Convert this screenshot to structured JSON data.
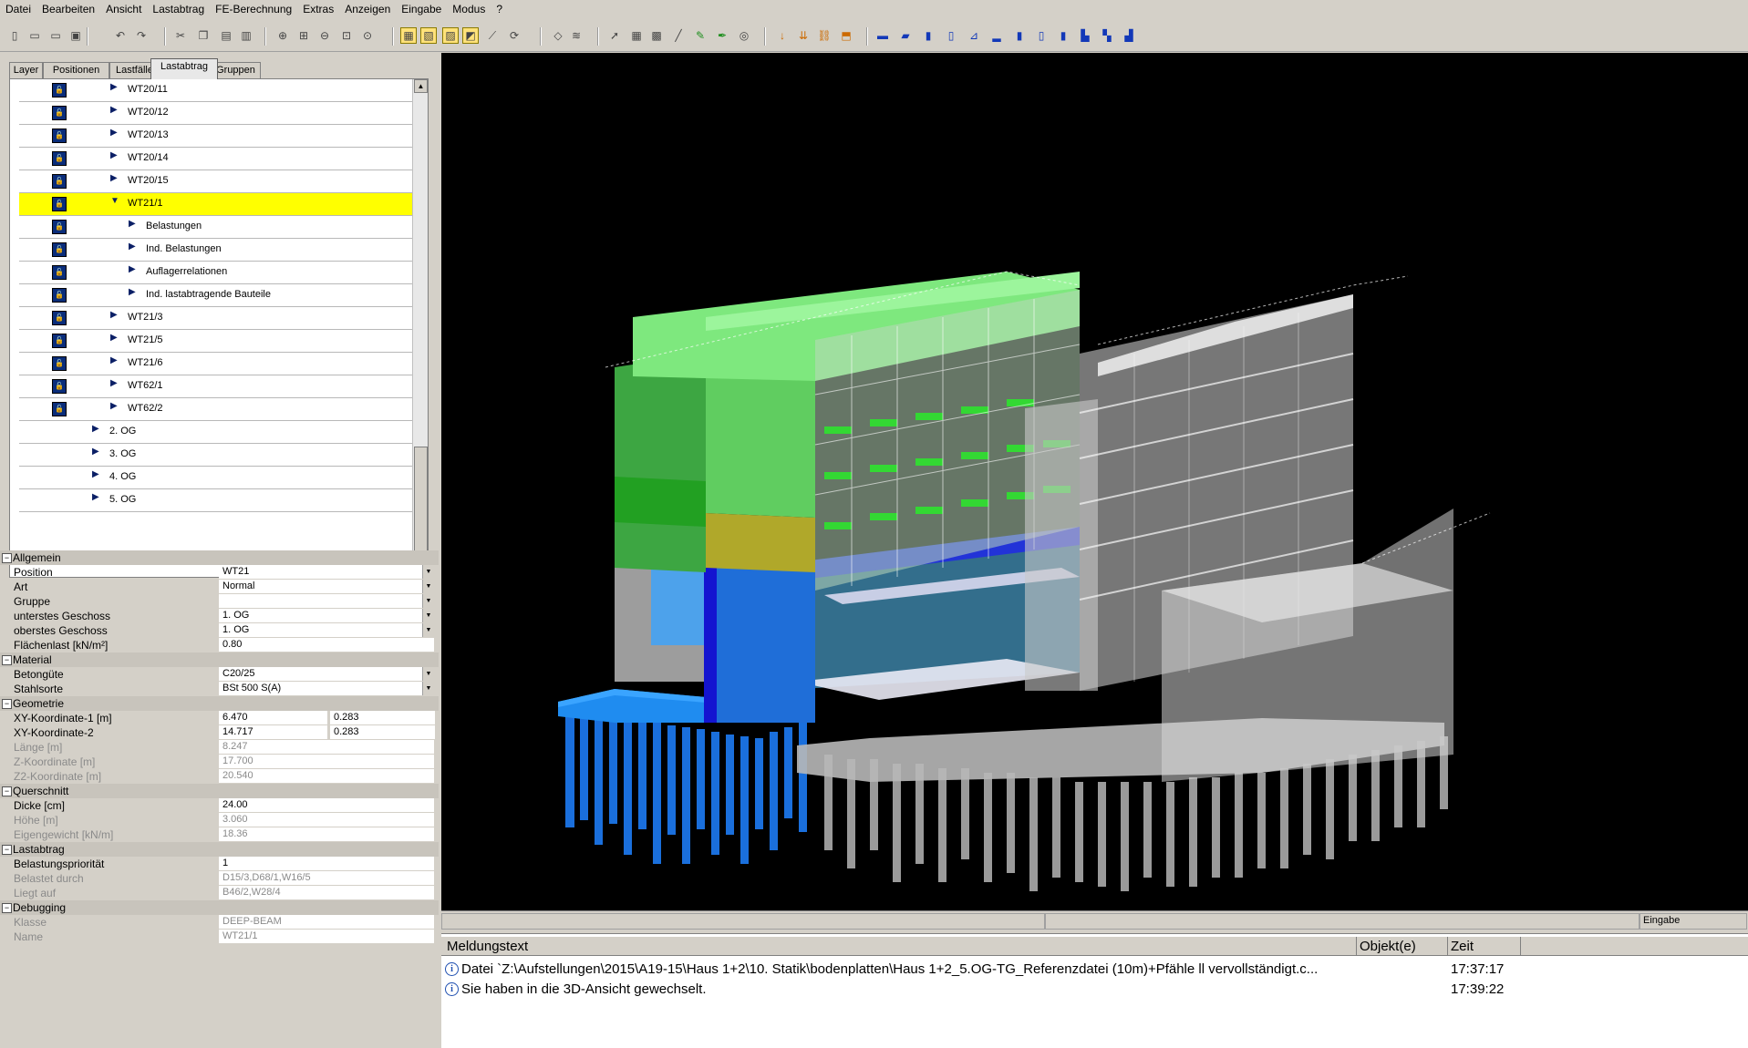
{
  "menu": [
    "Datei",
    "Bearbeiten",
    "Ansicht",
    "Lastabtrag",
    "FE-Berechnung",
    "Extras",
    "Anzeigen",
    "Eingabe",
    "Modus",
    "?"
  ],
  "toolbar_icons": [
    "new-file-icon",
    "open-file-icon",
    "open-file-icon",
    "save-icon",
    "undo-icon",
    "redo-icon",
    "cut-icon",
    "copy-icon",
    "paste-icon",
    "paste-special-icon",
    "zoom-in-icon",
    "zoom-window-icon",
    "zoom-out-icon",
    "zoom-all-icon",
    "zoom-previous-icon",
    "view-top-icon",
    "view-front-icon",
    "view-side-icon",
    "view-3d-icon",
    "measure-icon",
    "rotate-icon",
    "eraser-icon",
    "layers-icon",
    "select-arrow-icon",
    "grid-icon",
    "grid-fine-icon",
    "line-icon",
    "pencil-icon",
    "pen-icon",
    "snap-icon",
    "load-arrow-icon",
    "load-group-icon",
    "load-chain-icon",
    "load-area-icon",
    "beam-icon",
    "slab-icon",
    "wall-icon",
    "column-icon",
    "stair-icon",
    "foundation-icon"
  ],
  "tabs": [
    "Layer",
    "Positionen",
    "Lastfälle",
    "Lastabtrag",
    "Gruppen"
  ],
  "tree": [
    {
      "label": "WT20/11",
      "level": 2,
      "lock": true,
      "expanded": false,
      "selected": false
    },
    {
      "label": "WT20/12",
      "level": 2,
      "lock": true,
      "expanded": false,
      "selected": false
    },
    {
      "label": "WT20/13",
      "level": 2,
      "lock": true,
      "expanded": false,
      "selected": false
    },
    {
      "label": "WT20/14",
      "level": 2,
      "lock": true,
      "expanded": false,
      "selected": false
    },
    {
      "label": "WT20/15",
      "level": 2,
      "lock": true,
      "expanded": false,
      "selected": false
    },
    {
      "label": "WT21/1",
      "level": 2,
      "lock": true,
      "expanded": true,
      "selected": true
    },
    {
      "label": "Belastungen",
      "level": 3,
      "lock": true,
      "expanded": false,
      "selected": false
    },
    {
      "label": "Ind. Belastungen",
      "level": 3,
      "lock": true,
      "expanded": false,
      "selected": false
    },
    {
      "label": "Auflagerrelationen",
      "level": 3,
      "lock": true,
      "expanded": false,
      "selected": false
    },
    {
      "label": "Ind. lastabtragende Bauteile",
      "level": 3,
      "lock": true,
      "expanded": false,
      "selected": false
    },
    {
      "label": "WT21/3",
      "level": 2,
      "lock": true,
      "expanded": false,
      "selected": false
    },
    {
      "label": "WT21/5",
      "level": 2,
      "lock": true,
      "expanded": false,
      "selected": false
    },
    {
      "label": "WT21/6",
      "level": 2,
      "lock": true,
      "expanded": false,
      "selected": false
    },
    {
      "label": "WT62/1",
      "level": 2,
      "lock": true,
      "expanded": false,
      "selected": false
    },
    {
      "label": "WT62/2",
      "level": 2,
      "lock": true,
      "expanded": false,
      "selected": false
    },
    {
      "label": "2. OG",
      "level": 1,
      "lock": false,
      "expanded": false,
      "selected": false
    },
    {
      "label": "3. OG",
      "level": 1,
      "lock": false,
      "expanded": false,
      "selected": false
    },
    {
      "label": "4. OG",
      "level": 1,
      "lock": false,
      "expanded": false,
      "selected": false
    },
    {
      "label": "5. OG",
      "level": 1,
      "lock": false,
      "expanded": false,
      "selected": false
    }
  ],
  "properties": [
    {
      "type": "head",
      "label": "Allgemein"
    },
    {
      "type": "row",
      "label": "Position",
      "value": "WT21",
      "dropdown": true
    },
    {
      "type": "row",
      "label": "Art",
      "value": "Normal",
      "dropdown": true
    },
    {
      "type": "row",
      "label": "Gruppe",
      "value": "",
      "dropdown": true
    },
    {
      "type": "row",
      "label": "unterstes Geschoss",
      "value": "1. OG",
      "dropdown": true
    },
    {
      "type": "row",
      "label": "oberstes Geschoss",
      "value": "1. OG",
      "dropdown": true
    },
    {
      "type": "row",
      "label": "Flächenlast [kN/m²]",
      "value": "0.80"
    },
    {
      "type": "head",
      "label": "Material"
    },
    {
      "type": "row",
      "label": "Betongüte",
      "value": "C20/25",
      "dropdown": true
    },
    {
      "type": "row",
      "label": "Stahlsorte",
      "value": "BSt 500 S(A)",
      "dropdown": true
    },
    {
      "type": "head",
      "label": "Geometrie"
    },
    {
      "type": "row2",
      "label": "XY-Koordinate-1 [m]",
      "value": "6.470",
      "value2": "0.283"
    },
    {
      "type": "row2",
      "label": "XY-Koordinate-2",
      "value": "14.717",
      "value2": "0.283"
    },
    {
      "type": "row",
      "label": "Länge [m]",
      "value": "8.247",
      "grey": true
    },
    {
      "type": "row",
      "label": "Z-Koordinate [m]",
      "value": "17.700",
      "grey": true
    },
    {
      "type": "row",
      "label": "Z2-Koordinate [m]",
      "value": "20.540",
      "grey": true
    },
    {
      "type": "head",
      "label": "Querschnitt"
    },
    {
      "type": "row",
      "label": "Dicke [cm]",
      "value": "24.00"
    },
    {
      "type": "row",
      "label": "Höhe [m]",
      "value": "3.060",
      "grey": true
    },
    {
      "type": "row",
      "label": "Eigengewicht [kN/m]",
      "value": "18.36",
      "grey": true
    },
    {
      "type": "head",
      "label": "Lastabtrag"
    },
    {
      "type": "row",
      "label": "Belastungspriorität",
      "value": "1"
    },
    {
      "type": "row",
      "label": "Belastet durch",
      "value": "D15/3,D68/1,W16/5",
      "grey": true
    },
    {
      "type": "row",
      "label": "Liegt auf",
      "value": "B46/2,W28/4",
      "grey": true
    },
    {
      "type": "head",
      "label": "Debugging"
    },
    {
      "type": "row",
      "label": "Klasse",
      "value": "DEEP-BEAM",
      "grey": true
    },
    {
      "type": "row",
      "label": "Name",
      "value": "WT21/1",
      "grey": true
    }
  ],
  "status": {
    "mode": "Eingabe"
  },
  "messages": {
    "headers": {
      "text": "Meldungstext",
      "objects": "Objekt(e)",
      "time": "Zeit"
    },
    "rows": [
      {
        "text": "Datei `Z:\\Aufstellungen\\2015\\A19-15\\Haus 1+2\\10. Statik\\bodenplatten\\Haus 1+2_5.OG-TG_Referenzdatei (10m)+Pfähle ll vervollständigt.c...",
        "time": "17:37:17"
      },
      {
        "text": "Sie haben in die 3D-Ansicht gewechselt.",
        "time": "17:39:22"
      }
    ]
  },
  "colors": {
    "selection": "#ffff00",
    "viewport_bg": "#000000",
    "selected_green": "#4caf50",
    "highlight_blue": "#1a7de0",
    "pale_structure": "#cfcfcf"
  }
}
